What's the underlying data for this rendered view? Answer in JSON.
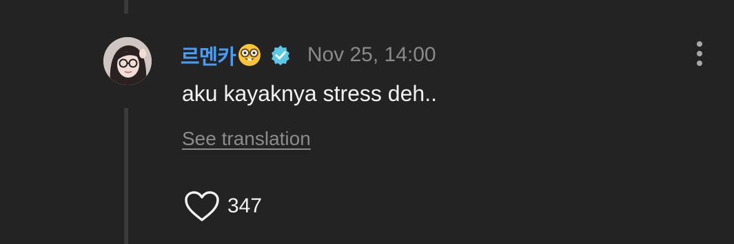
{
  "comment": {
    "username": "르멘카",
    "username_emoji": "nerd-face-icon",
    "verified_icon": "verified-badge-icon",
    "timestamp": "Nov 25, 14:00",
    "text": "aku kayaknya stress deh..",
    "translate_label": "See translation",
    "like_icon": "heart-outline-icon",
    "likes": "347",
    "more_icon": "more-vertical-icon"
  },
  "colors": {
    "background": "#232323",
    "username": "#4a9df7",
    "verified": "#5cc8e6",
    "text": "#f2f2f2",
    "muted": "#8c8c8c"
  }
}
